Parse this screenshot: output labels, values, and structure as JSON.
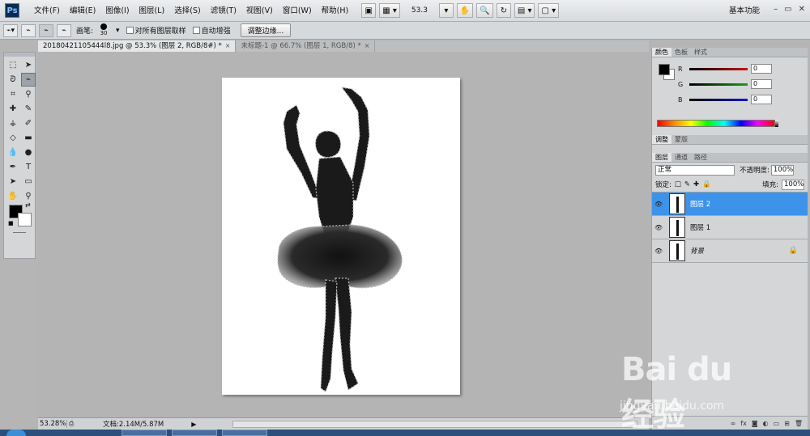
{
  "app": {
    "logo": "Ps"
  },
  "menu": [
    "文件(F)",
    "编辑(E)",
    "图像(I)",
    "图层(L)",
    "选择(S)",
    "滤镜(T)",
    "视图(V)",
    "窗口(W)",
    "帮助(H)"
  ],
  "menubar": {
    "zoom": "53.3",
    "workspace": "基本功能"
  },
  "options": {
    "brush_label": "画笔:",
    "brush_size": "30",
    "sample_all_layers": "对所有图层取样",
    "auto_enhance": "自动增强",
    "refine_edge": "调整边缘..."
  },
  "tabs": [
    {
      "title": "20180421105444l8.jpg @ 53.3% (图层 2, RGB/8#) *",
      "close": "×"
    },
    {
      "title": "未标题-1 @ 66.7% (图层 1, RGB/8) *",
      "close": "×"
    }
  ],
  "status": {
    "zoom": "53.28%",
    "doc_size": "文档:2.14M/5.87M"
  },
  "color_panel": {
    "tabs": [
      "颜色",
      "色板",
      "样式"
    ],
    "channels": [
      {
        "label": "R",
        "value": "0",
        "color": "#c01818"
      },
      {
        "label": "G",
        "value": "0",
        "color": "#18a018"
      },
      {
        "label": "B",
        "value": "0",
        "color": "#1818c0"
      }
    ]
  },
  "adjust_tabs": [
    "调整",
    "蒙版"
  ],
  "layers_panel": {
    "tabs": [
      "图层",
      "通道",
      "路径"
    ],
    "blend_mode": "正常",
    "opacity_label": "不透明度:",
    "opacity": "100%",
    "lock_label": "锁定:",
    "fill_label": "填充:",
    "fill": "100%",
    "layers": [
      {
        "name": "图层 2",
        "selected": true,
        "locked": false
      },
      {
        "name": "图层 1",
        "selected": false,
        "locked": false
      },
      {
        "name": "背景",
        "selected": false,
        "locked": true
      }
    ]
  },
  "watermark": {
    "logo": "Bai du 经验",
    "url": "jingyan.baidu.com"
  },
  "colors": {
    "selection": "#3d93ea",
    "panel_bg": "#d4d6d8",
    "canvas_bg": "#b4b4b4"
  }
}
